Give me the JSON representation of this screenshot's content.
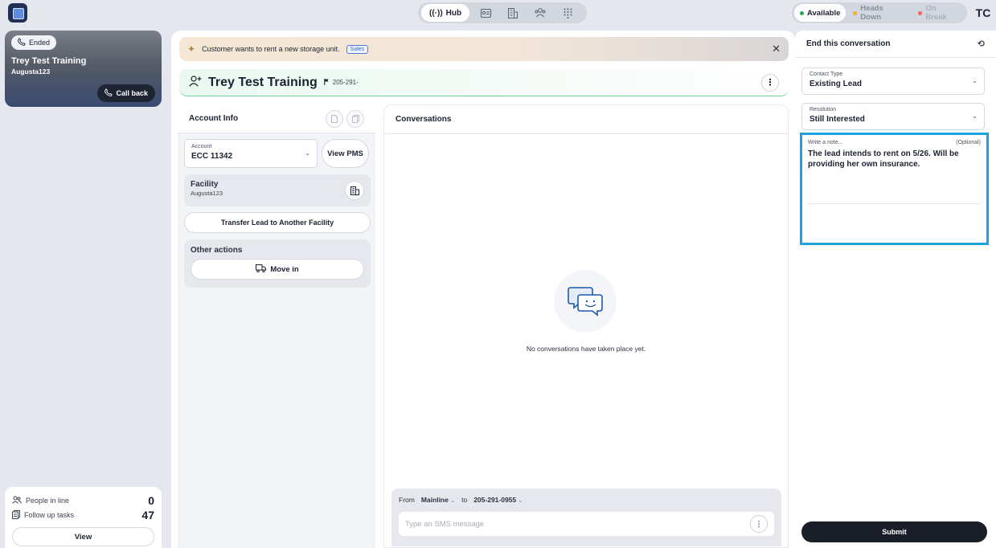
{
  "topnav": {
    "hub_label": "Hub",
    "icons": [
      "contact-card-icon",
      "building-icon",
      "people-group-icon",
      "dialpad-icon"
    ]
  },
  "status": {
    "available": "Available",
    "heads_down": "Heads Down",
    "on_break": "On Break",
    "colors": {
      "available": "#22a35a",
      "heads_down": "#f2b01e",
      "on_break": "#e86a6a"
    }
  },
  "user": {
    "initials": "TC"
  },
  "call_card": {
    "status": "Ended",
    "name": "Trey Test Training",
    "facility": "Augusta123",
    "callback_label": "Call back"
  },
  "queue": {
    "people_in_line_label": "People in line",
    "people_in_line_count": "0",
    "follow_up_label": "Follow up tasks",
    "follow_up_count": "47",
    "view_label": "View"
  },
  "banner": {
    "text": "Customer wants to rent a new storage unit.",
    "tag": "Sales"
  },
  "lead": {
    "name": "Trey Test Training",
    "phone": "205-291-"
  },
  "account_info": {
    "title": "Account Info",
    "account_label": "Account",
    "account_value": "ECC 11342",
    "view_pms_label": "View PMS",
    "facility_title": "Facility",
    "facility_value": "Augusta123",
    "transfer_label": "Transfer Lead to Another Facility",
    "other_actions_title": "Other actions",
    "move_in_label": "Move in"
  },
  "conversations": {
    "title": "Conversations",
    "empty_text": "No conversations have taken place yet.",
    "from_label": "From",
    "from_value": "Mainline",
    "to_label": "to",
    "to_value": "205-291-0955",
    "sms_placeholder": "Type an SMS message"
  },
  "end_conversation": {
    "title": "End this conversation",
    "contact_type_label": "Contact Type",
    "contact_type_value": "Existing Lead",
    "resolution_label": "Resolution",
    "resolution_value": "Still Interested",
    "note_label": "Write a note...",
    "note_optional": "(Optional)",
    "note_value": "The lead intends to rent on 5/26. Will be providing her own insurance.",
    "submit_label": "Submit"
  }
}
